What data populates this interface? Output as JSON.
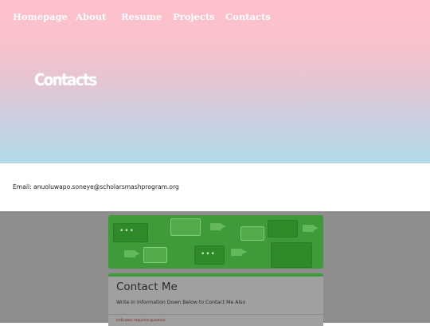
{
  "nav": {
    "items": [
      {
        "label": "Homepage"
      },
      {
        "label": "About"
      },
      {
        "label": "Resume"
      },
      {
        "label": "Projects"
      },
      {
        "label": "Contacts"
      }
    ]
  },
  "hero": {
    "title": "Contacts",
    "gradient_top": "#ffc0cb",
    "gradient_bottom": "#b2dbe8"
  },
  "contact": {
    "email_line": "Email: anuoluwapo.soneye@scholarsmashprogram.org"
  },
  "form": {
    "title": "Contact Me",
    "description": "Write In Information Down Below to Contact Me Also",
    "note": "Indicates required question",
    "accent_color": "#3f9a3a"
  }
}
